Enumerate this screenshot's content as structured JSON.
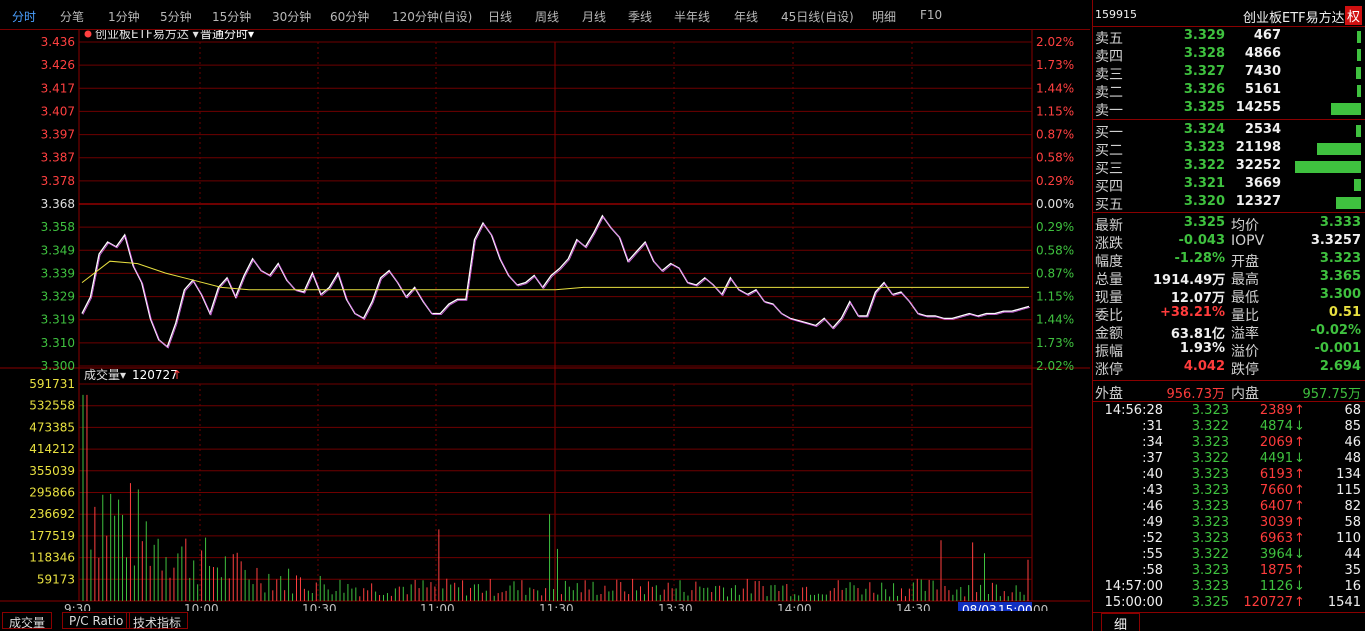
{
  "tabs": [
    "分时",
    "分笔",
    "1分钟",
    "5分钟",
    "15分钟",
    "30分钟",
    "60分钟",
    "120分钟(自设)",
    "日线",
    "周线",
    "月线",
    "季线",
    "半年线",
    "年线",
    "45日线(自设)",
    "明细",
    "F10"
  ],
  "chart": {
    "title": "创业板ETF易方达",
    "mode": "普通分时",
    "vol_label": "成交量",
    "vol_value": "120727",
    "vol_arrow": "↑",
    "date_label": "08/03",
    "time_label": "15:00",
    "x_ticks": [
      "9:30",
      "10:00",
      "10:30",
      "11:00",
      "11:30",
      "13:30",
      "14:00",
      "14:30",
      "15:00"
    ],
    "price_left": [
      "3.436",
      "3.426",
      "3.417",
      "3.407",
      "3.397",
      "3.387",
      "3.378",
      "3.368",
      "3.358",
      "3.349",
      "3.339",
      "3.329",
      "3.319",
      "3.310",
      "3.300"
    ],
    "pct_right": [
      "2.02%",
      "1.73%",
      "1.44%",
      "1.15%",
      "0.87%",
      "0.58%",
      "0.29%",
      "0.00%",
      "0.29%",
      "0.58%",
      "0.87%",
      "1.15%",
      "1.44%",
      "1.73%",
      "2.02%"
    ],
    "vol_ticks": [
      "591731",
      "532558",
      "473385",
      "414212",
      "355039",
      "295866",
      "236692",
      "177519",
      "118346",
      "59173"
    ]
  },
  "chart_data": {
    "type": "line",
    "series": [
      {
        "values": [
          3.322,
          3.329,
          3.347,
          3.352,
          3.35,
          3.355,
          3.342,
          3.335,
          3.32,
          3.311,
          3.308,
          3.318,
          3.332,
          3.336,
          3.33,
          3.322,
          3.333,
          3.337,
          3.329,
          3.338,
          3.345,
          3.34,
          3.338,
          3.343,
          3.336,
          3.332,
          3.331,
          3.339,
          3.33,
          3.333,
          3.339,
          3.328,
          3.322,
          3.32,
          3.327,
          3.337,
          3.34,
          3.335,
          3.329,
          3.333,
          3.327,
          3.322,
          3.322,
          3.326,
          3.328,
          3.328,
          3.353,
          3.36,
          3.355,
          3.345,
          3.338,
          3.334,
          3.335,
          3.338,
          3.333,
          3.338,
          3.341,
          3.345,
          3.353,
          3.35,
          3.356,
          3.363,
          3.358,
          3.354,
          3.344,
          3.348,
          3.352,
          3.344,
          3.34,
          3.343,
          3.341,
          3.335,
          3.334,
          3.337,
          3.334,
          3.33,
          3.337,
          3.332,
          3.33,
          3.332,
          3.327,
          3.326,
          3.322,
          3.32,
          3.319,
          3.318,
          3.317,
          3.32,
          3.316,
          3.32,
          3.327,
          3.321,
          3.321,
          3.331,
          3.335,
          3.33,
          3.331,
          3.327,
          3.322,
          3.321,
          3.321,
          3.32,
          3.32,
          3.321,
          3.322,
          3.321,
          3.322,
          3.322,
          3.323,
          3.323,
          3.324,
          3.325
        ]
      },
      {
        "values": [
          3.335,
          3.344,
          3.343,
          3.339,
          3.336,
          3.333,
          3.332,
          3.332,
          3.332,
          3.332,
          3.332,
          3.332,
          3.332,
          3.332,
          3.332,
          3.332,
          3.332,
          3.332,
          3.333,
          3.333,
          3.333,
          3.333,
          3.333,
          3.333,
          3.333,
          3.333,
          3.333,
          3.333,
          3.333,
          3.333,
          3.333,
          3.333,
          3.333,
          3.333,
          3.333
        ]
      }
    ],
    "yprice": [
      3.3,
      3.436
    ],
    "ref_price": 3.368,
    "volume_max": 591731
  },
  "orderbook": {
    "code": "159915",
    "name": "创业板ETF易方达",
    "badge": "权",
    "asks": [
      {
        "label": "卖五",
        "price": "3.329",
        "vol": "467",
        "bar": 0.03
      },
      {
        "label": "卖四",
        "price": "3.328",
        "vol": "4866",
        "bar": 0.05
      },
      {
        "label": "卖三",
        "price": "3.327",
        "vol": "7430",
        "bar": 0.08
      },
      {
        "label": "卖二",
        "price": "3.326",
        "vol": "5161",
        "bar": 0.05
      },
      {
        "label": "卖一",
        "price": "3.325",
        "vol": "14255",
        "bar": 0.45
      }
    ],
    "bids": [
      {
        "label": "买一",
        "price": "3.324",
        "vol": "2534",
        "bar": 0.08
      },
      {
        "label": "买二",
        "price": "3.323",
        "vol": "21198",
        "bar": 0.66
      },
      {
        "label": "买三",
        "price": "3.322",
        "vol": "32252",
        "bar": 1.0
      },
      {
        "label": "买四",
        "price": "3.321",
        "vol": "3669",
        "bar": 0.11
      },
      {
        "label": "买五",
        "price": "3.320",
        "vol": "12327",
        "bar": 0.38
      }
    ]
  },
  "stats": [
    {
      "l": "最新",
      "v": "3.325",
      "vc": "green",
      "l2": "均价",
      "v2": "3.333",
      "v2c": "green"
    },
    {
      "l": "涨跌",
      "v": "-0.043",
      "vc": "green",
      "l2": "IOPV",
      "v2": "3.3257",
      "v2c": "white"
    },
    {
      "l": "幅度",
      "v": "-1.28%",
      "vc": "green",
      "l2": "开盘",
      "v2": "3.323",
      "v2c": "green"
    },
    {
      "l": "总量",
      "v": "1914.49万",
      "vc": "white",
      "l2": "最高",
      "v2": "3.365",
      "v2c": "green"
    },
    {
      "l": "现量",
      "v": "12.07万",
      "vc": "white",
      "l2": "最低",
      "v2": "3.300",
      "v2c": "green"
    },
    {
      "l": "委比",
      "v": "+38.21%",
      "vc": "red",
      "l2": "量比",
      "v2": "0.51",
      "v2c": "yellow"
    },
    {
      "l": "金额",
      "v": "63.81亿",
      "vc": "white",
      "l2": "溢率",
      "v2": "-0.02%",
      "v2c": "green"
    },
    {
      "l": "振幅",
      "v": "1.93%",
      "vc": "white",
      "l2": "溢价",
      "v2": "-0.001",
      "v2c": "green"
    },
    {
      "l": "涨停",
      "v": "4.042",
      "vc": "red",
      "l2": "跌停",
      "v2": "2.694",
      "v2c": "green"
    }
  ],
  "outer_inner": {
    "outer_label": "外盘",
    "outer": "956.73万",
    "inner_label": "内盘",
    "inner": "957.75万"
  },
  "ticks": [
    {
      "t": "14:56:28",
      "p": "3.323",
      "v": "2389",
      "d": "↑",
      "dc": "red",
      "n": "68"
    },
    {
      "t": ":31",
      "p": "3.322",
      "v": "4874",
      "d": "↓",
      "dc": "green",
      "n": "85"
    },
    {
      "t": ":34",
      "p": "3.323",
      "v": "2069",
      "d": "↑",
      "dc": "red",
      "n": "46"
    },
    {
      "t": ":37",
      "p": "3.322",
      "v": "4491",
      "d": "↓",
      "dc": "green",
      "n": "48"
    },
    {
      "t": ":40",
      "p": "3.323",
      "v": "6193",
      "d": "↑",
      "dc": "red",
      "n": "134"
    },
    {
      "t": ":43",
      "p": "3.323",
      "v": "7660",
      "d": "↑",
      "dc": "red",
      "n": "115"
    },
    {
      "t": ":46",
      "p": "3.323",
      "v": "6407",
      "d": "↑",
      "dc": "red",
      "n": "82"
    },
    {
      "t": ":49",
      "p": "3.323",
      "v": "3039",
      "d": "↑",
      "dc": "red",
      "n": "58"
    },
    {
      "t": ":52",
      "p": "3.323",
      "v": "6963",
      "d": "↑",
      "dc": "red",
      "n": "110"
    },
    {
      "t": ":55",
      "p": "3.322",
      "v": "3964",
      "d": "↓",
      "dc": "green",
      "n": "44"
    },
    {
      "t": ":58",
      "p": "3.323",
      "v": "1875",
      "d": "↑",
      "dc": "red",
      "n": "35"
    },
    {
      "t": "14:57:00",
      "p": "3.323",
      "v": "1126",
      "d": "↓",
      "dc": "green",
      "n": "16"
    },
    {
      "t": "15:00:00",
      "p": "3.325",
      "v": "120727",
      "d": "↑",
      "dc": "red",
      "n": "1541"
    }
  ],
  "bottom_tabs": [
    "成交量",
    "P/C Ratio",
    "技术指标"
  ],
  "detail_tab": "细"
}
